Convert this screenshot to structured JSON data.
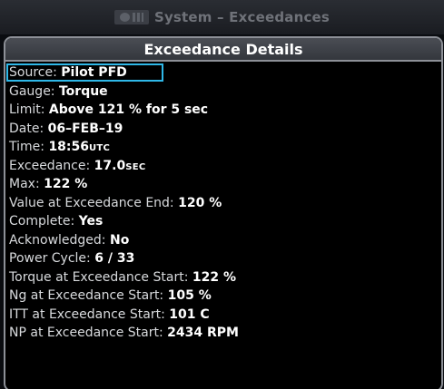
{
  "title_bar": {
    "text": "System – Exceedances"
  },
  "panel": {
    "header": "Exceedance Details",
    "rows": [
      {
        "label": "Source:",
        "value": "Pilot PFD",
        "selected": true
      },
      {
        "label": "Gauge:",
        "value": "Torque"
      },
      {
        "label": "Limit:",
        "value": "Above 121 % for 5 sec"
      },
      {
        "label": "Date:",
        "value": "06–FEB–19"
      },
      {
        "label": "Time:",
        "value": "18:56",
        "unit": "UTC"
      },
      {
        "label": "Exceedance:",
        "value": "17.0",
        "unit": "SEC"
      },
      {
        "label": "Max:",
        "value": "122 %"
      },
      {
        "label": "Value at Exceedance End:",
        "value": "120 %"
      },
      {
        "label": "Complete:",
        "value": "Yes"
      },
      {
        "label": "Acknowledged:",
        "value": "No"
      },
      {
        "label": "Power Cycle:",
        "value": "6 / 33"
      },
      {
        "label": "Torque at Exceedance Start:",
        "value": "122 %"
      },
      {
        "label": "Ng at Exceedance Start:",
        "value": "105 %"
      },
      {
        "label": "ITT at Exceedance Start:",
        "value": "101 C"
      },
      {
        "label": "NP at Exceedance Start:",
        "value": "2434 RPM"
      }
    ]
  },
  "colors": {
    "background": "#000000",
    "border": "#8d9097",
    "selection": "#2fb8e8",
    "text": "#ffffff",
    "title_text": "#6f7279"
  },
  "icons": [
    "garmin-logo-icon"
  ]
}
